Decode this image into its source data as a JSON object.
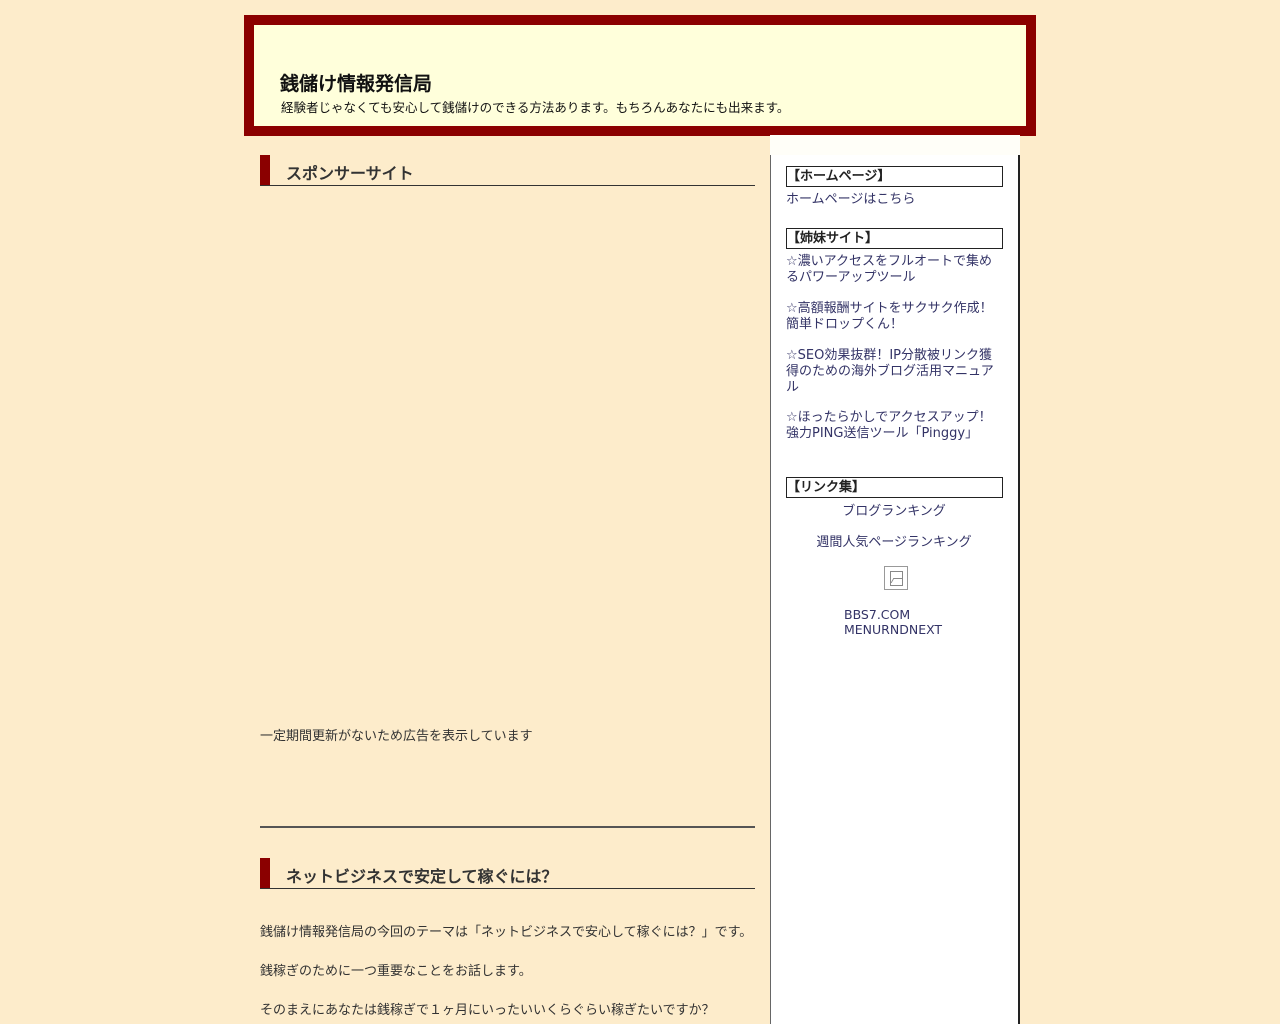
{
  "header": {
    "title": "銭儲け情報発信局",
    "description": "経験者じゃなくても安心して銭儲けのできる方法あります。もちろんあなたにも出来ます。"
  },
  "main": {
    "sponsor_title": "スポンサーサイト",
    "ad_notice": "一定期間更新がないため広告を表示しています",
    "entry": {
      "title": "ネットビジネスで安定して稼ぐには？",
      "paragraphs": [
        "銭儲け情報発信局の今回のテーマは「ネットビジネスで安心して稼ぐには？」です。",
        "銭稼ぎのために一つ重要なことをお話します。",
        "そのまえにあなたは銭稼ぎで１ヶ月にいったいいくらぐらい稼ぎたいですか？"
      ]
    }
  },
  "sidebar": {
    "homepage": {
      "title": "【ホームページ】",
      "link": "ホームページはこちら"
    },
    "sister_sites": {
      "title": "【姉妹サイト】",
      "links": [
        "☆濃いアクセスをフルオートで集めるパワーアップツール",
        "☆高額報酬サイトをサクサク作成！簡単ドロップくん！",
        "☆SEO効果抜群！IP分散被リンク獲得のための海外ブログ活用マニュアル",
        "☆ほったらかしでアクセスアップ！強力PING送信ツール「Pinggy」"
      ]
    },
    "links": {
      "title": "【リンク集】",
      "items": [
        "ブログランキング",
        "週間人気ページランキング"
      ],
      "image_icon": "broken-image-icon",
      "bbs_line1": "BBS7.COM",
      "bbs_line2": "MENURNDNEXT"
    }
  },
  "colors": {
    "background": "#fdeccb",
    "header_border": "#8b0000",
    "header_bg": "#ffffdb",
    "title_marker": "#8b0000",
    "link": "#333366"
  }
}
